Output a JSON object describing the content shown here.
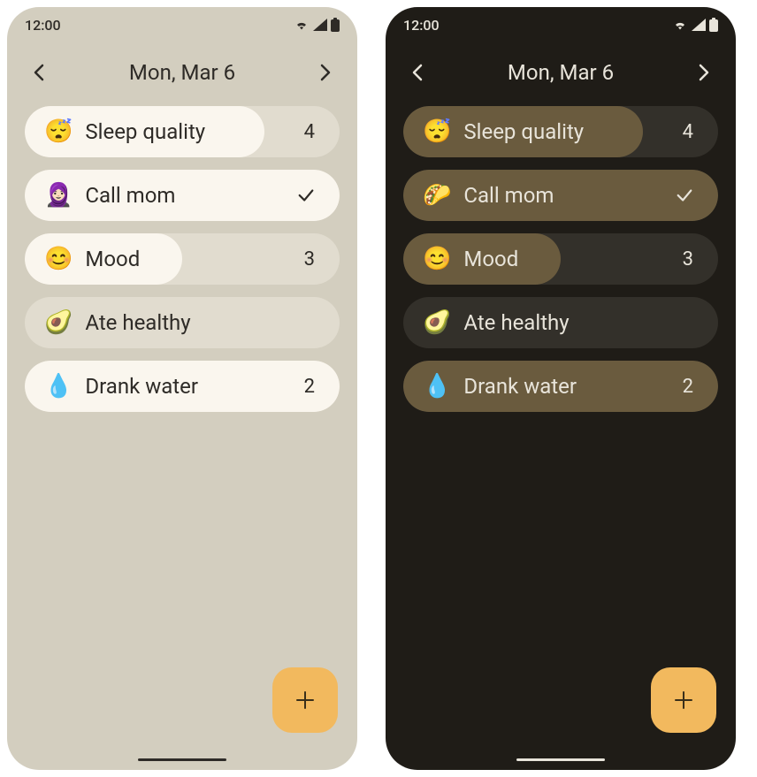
{
  "status": {
    "time": "12:00"
  },
  "header": {
    "date": "Mon, Mar 6"
  },
  "habits": {
    "light": [
      {
        "emoji": "😴",
        "label": "Sleep quality",
        "value": "4",
        "type": "number",
        "fill": 76
      },
      {
        "emoji": "🧕🏻",
        "label": "Call mom",
        "value": "check",
        "type": "check",
        "fill": 100
      },
      {
        "emoji": "😊",
        "label": "Mood",
        "value": "3",
        "type": "number",
        "fill": 50
      },
      {
        "emoji": "🥑",
        "label": "Ate healthy",
        "value": "",
        "type": "none",
        "fill": 0
      },
      {
        "emoji": "💧",
        "label": "Drank water",
        "value": "2",
        "type": "number",
        "fill": 100
      }
    ],
    "dark": [
      {
        "emoji": "😴",
        "label": "Sleep quality",
        "value": "4",
        "type": "number",
        "fill": 76
      },
      {
        "emoji": "🌮",
        "label": "Call mom",
        "value": "check",
        "type": "check",
        "fill": 100
      },
      {
        "emoji": "😊",
        "label": "Mood",
        "value": "3",
        "type": "number",
        "fill": 50
      },
      {
        "emoji": "🥑",
        "label": "Ate healthy",
        "value": "",
        "type": "none",
        "fill": 0
      },
      {
        "emoji": "💧",
        "label": "Drank water",
        "value": "2",
        "type": "number",
        "fill": 100
      }
    ]
  },
  "colors": {
    "light_bg": "#d3cebf",
    "dark_bg": "#1f1c17",
    "fab": "#f2b95e"
  }
}
